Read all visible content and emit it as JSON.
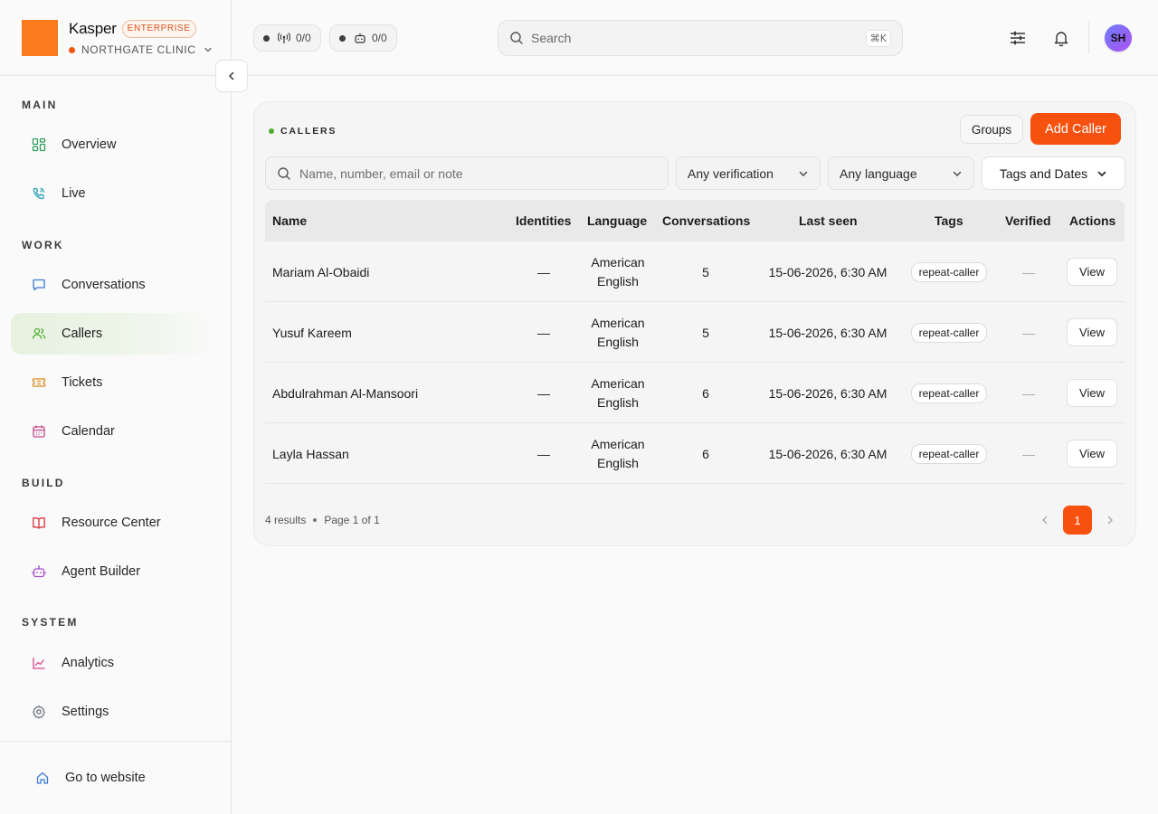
{
  "brand": {
    "name": "Kasper",
    "badge": "ENTERPRISE",
    "org": "NORTHGATE CLINIC",
    "logo_color": "#fb7a1c",
    "org_dot_color": "#f25410"
  },
  "status_pills": [
    {
      "icon": "antenna-icon",
      "count": "0/0"
    },
    {
      "icon": "robot-icon",
      "count": "0/0"
    }
  ],
  "search": {
    "placeholder": "Search",
    "shortcut": "⌘K"
  },
  "user": {
    "initials": "SH"
  },
  "sidebar": {
    "sections": [
      {
        "title": "MAIN",
        "items": [
          {
            "label": "Overview",
            "icon": "grid-icon"
          },
          {
            "label": "Live",
            "icon": "phone-live-icon"
          }
        ]
      },
      {
        "title": "WORK",
        "items": [
          {
            "label": "Conversations",
            "icon": "chat-icon"
          },
          {
            "label": "Callers",
            "icon": "users-icon",
            "active": true
          },
          {
            "label": "Tickets",
            "icon": "ticket-icon"
          },
          {
            "label": "Calendar",
            "icon": "calendar-icon"
          }
        ]
      },
      {
        "title": "BUILD",
        "items": [
          {
            "label": "Resource Center",
            "icon": "book-icon"
          },
          {
            "label": "Agent Builder",
            "icon": "robot-icon"
          }
        ]
      },
      {
        "title": "SYSTEM",
        "items": [
          {
            "label": "Analytics",
            "icon": "chart-line-icon"
          },
          {
            "label": "Settings",
            "icon": "gear-icon"
          }
        ]
      }
    ],
    "footer_link": "Go to website"
  },
  "callers": {
    "title": "CALLERS",
    "groups_label": "Groups",
    "add_label": "Add Caller",
    "filter_placeholder": "Name, number, email or note",
    "verification_filter": "Any verification",
    "language_filter": "Any language",
    "tags_dates_filter": "Tags and Dates",
    "columns": [
      "Name",
      "Identities",
      "Language",
      "Conversations",
      "Last seen",
      "Tags",
      "Verified",
      "Actions"
    ],
    "rows": [
      {
        "name": "Mariam Al-Obaidi",
        "identities": "—",
        "language_1": "American",
        "language_2": "English",
        "conversations": "5",
        "last_seen": "15-06-2026, 6:30 AM",
        "tag": "repeat-caller",
        "verified": "—",
        "action": "View"
      },
      {
        "name": "Yusuf Kareem",
        "identities": "—",
        "language_1": "American",
        "language_2": "English",
        "conversations": "5",
        "last_seen": "15-06-2026, 6:30 AM",
        "tag": "repeat-caller",
        "verified": "—",
        "action": "View"
      },
      {
        "name": "Abdulrahman Al-Mansoori",
        "identities": "—",
        "language_1": "American",
        "language_2": "English",
        "conversations": "6",
        "last_seen": "15-06-2026, 6:30 AM",
        "tag": "repeat-caller",
        "verified": "—",
        "action": "View"
      },
      {
        "name": "Layla Hassan",
        "identities": "—",
        "language_1": "American",
        "language_2": "English",
        "conversations": "6",
        "last_seen": "15-06-2026, 6:30 AM",
        "tag": "repeat-caller",
        "verified": "—",
        "action": "View"
      }
    ],
    "results_text": "4 results",
    "page_text": "Page 1 of 1",
    "current_page": "1"
  },
  "colors": {
    "accent": "#f7510f",
    "active_nav_bg": "#e6f1df"
  }
}
